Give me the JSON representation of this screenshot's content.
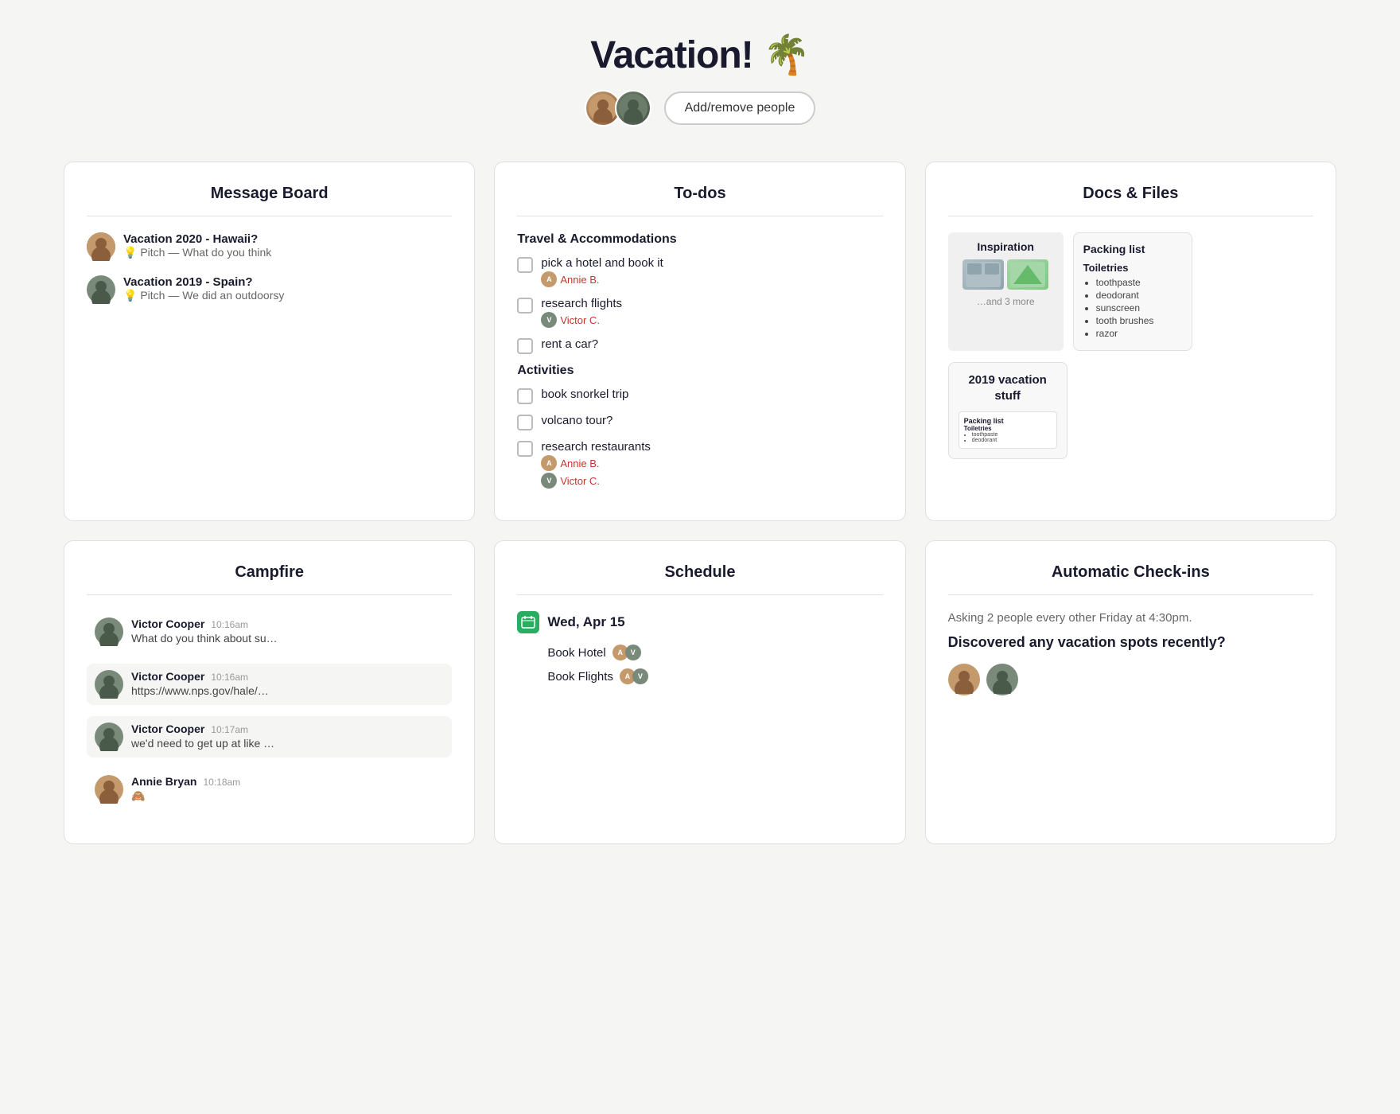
{
  "header": {
    "title": "Vacation! 🌴",
    "add_people_label": "Add/remove people"
  },
  "message_board": {
    "title": "Message Board",
    "messages": [
      {
        "title": "Vacation 2020 - Hawaii?",
        "subtitle": "💡 Pitch — What do you think",
        "avatar_color": "#8b6347"
      },
      {
        "title": "Vacation 2019 - Spain?",
        "subtitle": "💡 Pitch — We did an outdoorsy",
        "avatar_color": "#5a6a5a"
      }
    ]
  },
  "todos": {
    "title": "To-dos",
    "sections": [
      {
        "title": "Travel & Accommodations",
        "items": [
          {
            "text": "pick a hotel and book it",
            "assignee": "Annie B.",
            "assignee_color": "#c0392b"
          },
          {
            "text": "research flights",
            "assignee": "Victor C.",
            "assignee_color": "#c0392b"
          },
          {
            "text": "rent a car?",
            "assignee": null
          }
        ]
      },
      {
        "title": "Activities",
        "items": [
          {
            "text": "book snorkel trip",
            "assignee": null
          },
          {
            "text": "volcano tour?",
            "assignee": null
          },
          {
            "text": "research restaurants",
            "assignee": "Annie B.",
            "assignee2": "Victor C.",
            "assignee_color": "#c0392b"
          }
        ]
      }
    ]
  },
  "docs_files": {
    "title": "Docs & Files",
    "inspiration_card": {
      "title": "Inspiration",
      "more": "…and 3 more"
    },
    "packing_list": {
      "title": "Packing list",
      "subtitle": "Toiletries",
      "items": [
        "toothpaste",
        "deodorant",
        "sunscreen",
        "tooth brushes",
        "razor"
      ]
    },
    "folder_2019": {
      "title": "2019 vacation stuff",
      "inner_title": "Packing list",
      "inner_subtitle": "Toiletries",
      "inner_items": [
        "toothpaste",
        "deodorant"
      ]
    }
  },
  "campfire": {
    "title": "Campfire",
    "messages": [
      {
        "name": "Victor Cooper",
        "time": "10:16am",
        "text": "What do you think about su…",
        "avatar_color": "#5a6a5a",
        "highlighted": false
      },
      {
        "name": "Victor Cooper",
        "time": "10:16am",
        "text": "https://www.nps.gov/hale/…",
        "avatar_color": "#5a6a5a",
        "highlighted": true
      },
      {
        "name": "Victor Cooper",
        "time": "10:17am",
        "text": "we'd need to get up at like …",
        "avatar_color": "#5a6a5a",
        "highlighted": true
      },
      {
        "name": "Annie Bryan",
        "time": "10:18am",
        "text": "🙈",
        "avatar_color": "#8b6347",
        "highlighted": false
      }
    ]
  },
  "schedule": {
    "title": "Schedule",
    "date_label": "Wed, Apr 15",
    "events": [
      {
        "name": "Book Hotel"
      },
      {
        "name": "Book Flights"
      }
    ]
  },
  "automatic_checkins": {
    "title": "Automatic Check-ins",
    "description": "Asking 2 people every other Friday at 4:30pm.",
    "question": "Discovered any vacation spots recently?"
  }
}
